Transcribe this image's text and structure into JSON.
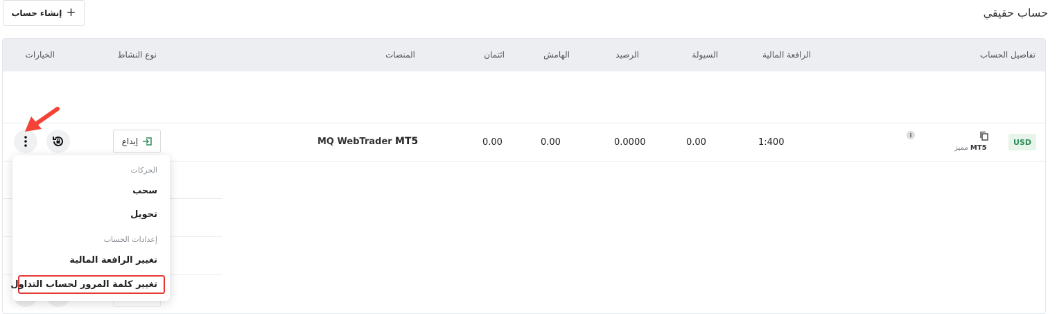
{
  "header": {
    "title": "حساب حقيقي",
    "create_button_label": "إنشاء حساب"
  },
  "table": {
    "columns": {
      "account_details": "تفاصيل الحساب",
      "leverage": "الرافعة المالية",
      "liquidity": "السيولة",
      "balance": "الرصيد",
      "margin": "الهامش",
      "credit": "ائتمان",
      "platforms": "المنصات",
      "activity_type": "نوع النشاط",
      "options": "الخيارات"
    },
    "row": {
      "currency": "USD",
      "platform_badge": "MT5",
      "account_type": "مميز",
      "leverage": "1:400",
      "liquidity": "0.00",
      "balance": "0.0000",
      "margin": "0.00",
      "credit": "0.00",
      "platform_mt5": "MT5",
      "platform_webtrader": "MQ WebTrader",
      "deposit_label": "إيداع"
    }
  },
  "dropdown": {
    "group_transactions": "الحركات",
    "withdraw": "سحب",
    "transfer": "تحويل",
    "group_account_settings": "إعدادات الحساب",
    "change_leverage": "تغيير الرافعة المالية",
    "change_password": "تغيير كلمة المرور لحساب التداول"
  },
  "colors": {
    "highlight": "#e53935",
    "arrow": "#f44336",
    "badge_green": "#2e8b57",
    "deposit_icon": "#2e8b57"
  },
  "icons": {
    "create": "plus-icon",
    "copy": "copy-icon",
    "info": "info-icon",
    "deposit": "login-arrow-icon",
    "reset": "reset-lock-icon",
    "menu": "kebab-menu-icon",
    "pointer": "red-arrow-icon"
  }
}
